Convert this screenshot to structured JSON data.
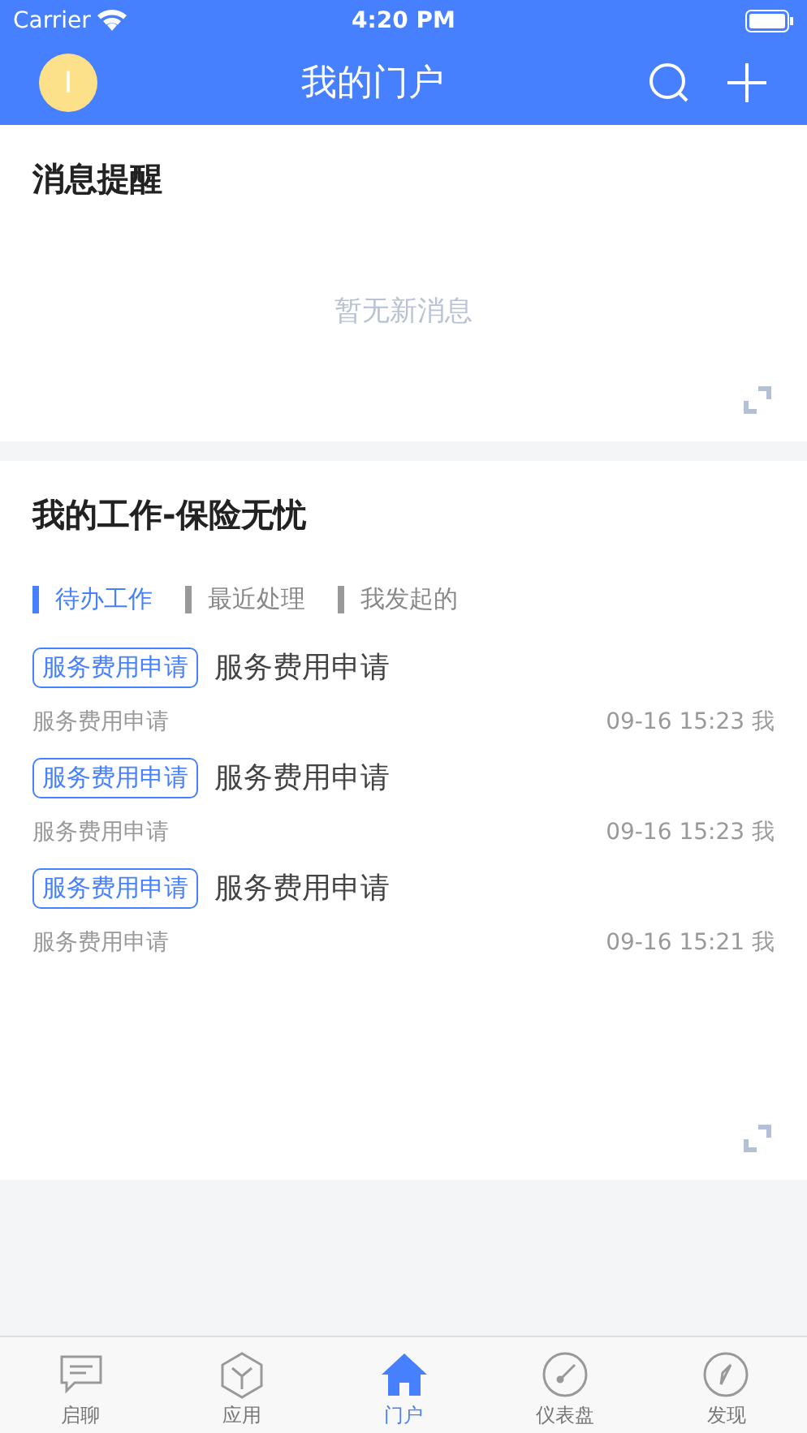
{
  "status_bar": {
    "carrier": "Carrier",
    "time": "4:20 PM"
  },
  "nav": {
    "avatar_letter": "I",
    "title": "我的门户"
  },
  "messages": {
    "title": "消息提醒",
    "empty": "暂无新消息"
  },
  "work": {
    "title": "我的工作-保险无忧",
    "tabs": [
      {
        "label": "待办工作",
        "selected": true
      },
      {
        "label": "最近处理",
        "selected": false
      },
      {
        "label": "我发起的",
        "selected": false
      }
    ],
    "items": [
      {
        "tag": "服务费用申请",
        "title": "服务费用申请",
        "subtitle": "服务费用申请",
        "time": "09-16 15:23",
        "owner": "我"
      },
      {
        "tag": "服务费用申请",
        "title": "服务费用申请",
        "subtitle": "服务费用申请",
        "time": "09-16 15:23",
        "owner": "我"
      },
      {
        "tag": "服务费用申请",
        "title": "服务费用申请",
        "subtitle": "服务费用申请",
        "time": "09-16 15:21",
        "owner": "我"
      }
    ]
  },
  "tab_bar": [
    {
      "label": "启聊",
      "selected": false
    },
    {
      "label": "应用",
      "selected": false
    },
    {
      "label": "门户",
      "selected": true
    },
    {
      "label": "仪表盘",
      "selected": false
    },
    {
      "label": "发现",
      "selected": false
    }
  ]
}
